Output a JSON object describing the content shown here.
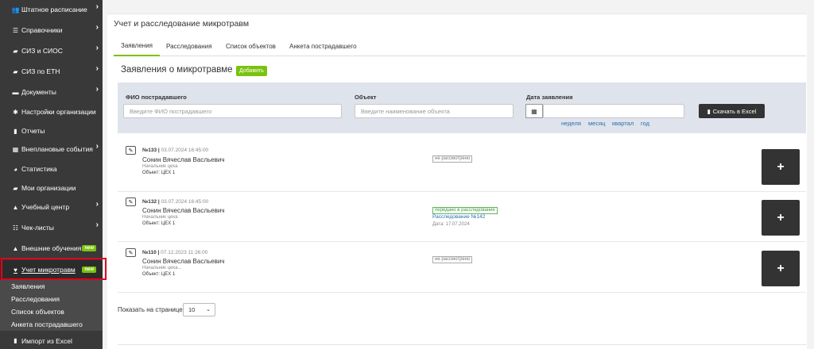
{
  "sidebar": {
    "items": [
      {
        "label": "Штатное расписание",
        "icon": "users-icon",
        "glyph": "👥",
        "chevron": true
      },
      {
        "label": "Справочники",
        "icon": "list-icon",
        "glyph": "☰",
        "chevron": true
      },
      {
        "label": "СИЗ и СИОС",
        "icon": "briefcase-icon",
        "glyph": "▰",
        "chevron": true
      },
      {
        "label": "СИЗ по ЕТН",
        "icon": "briefcase-icon",
        "glyph": "▰",
        "chevron": true
      },
      {
        "label": "Документы",
        "icon": "folder-icon",
        "glyph": "▬",
        "chevron": true
      },
      {
        "label": "Настройки организации",
        "icon": "gear-icon",
        "glyph": "✱",
        "chevron": false
      },
      {
        "label": "Отчеты",
        "icon": "clipboard-icon",
        "glyph": "▮",
        "chevron": false
      },
      {
        "label": "Внеплановые события",
        "icon": "calendar-icon",
        "glyph": "▦",
        "chevron": true
      },
      {
        "label": "Статистика",
        "icon": "pie-chart-icon",
        "glyph": "◕",
        "chevron": false
      },
      {
        "label": "Мои организации",
        "icon": "briefcase-icon",
        "glyph": "▰",
        "chevron": false
      },
      {
        "label": "Учебный центр",
        "icon": "graduation-cap-icon",
        "glyph": "▲",
        "chevron": true
      },
      {
        "label": "Чек-листы",
        "icon": "checklist-icon",
        "glyph": "☷",
        "chevron": true
      },
      {
        "label": "Внешние обучения",
        "icon": "graduation-cap-icon",
        "glyph": "▲",
        "badge": "new"
      },
      {
        "label": "Учет микротравм",
        "icon": "heart-icon",
        "glyph": "♥",
        "badge": "new"
      }
    ],
    "submenu": [
      "Заявления",
      "Расследования",
      "Список объектов",
      "Анкета пострадавшего"
    ],
    "bottom_item": {
      "label": "Импорт из Excel",
      "icon": "file-icon",
      "glyph": "▮"
    }
  },
  "page": {
    "title": "Учет и расследование микротравм",
    "tabs": [
      "Заявления",
      "Расследования",
      "Список объектов",
      "Анкета пострадавшего"
    ],
    "section_title": "Заявления о микротравме",
    "add_label": "Добавить"
  },
  "filters": {
    "fio_label": "ФИО пострадавшего",
    "fio_placeholder": "Введите ФИО пострадавшего",
    "object_label": "Объект",
    "object_placeholder": "Введите наименование объекта",
    "date_label": "Дата заявления",
    "ranges": [
      "неделя",
      "месяц",
      "квартал",
      "год"
    ],
    "excel_label": "Скачать в Excel"
  },
  "rows": [
    {
      "num": "№133",
      "date": "03.07.2024 16:45:00",
      "name": "Сонин Вячеслав Васльевич",
      "position": "Начальник цеха",
      "object": "Объект: ЦЕХ 1",
      "status": "не рассмотрено",
      "status_type": "gray",
      "investigation": "",
      "inv_date": ""
    },
    {
      "num": "№132",
      "date": "03.07.2024 16:45:00",
      "name": "Сонин Вячеслав Васльевич",
      "position": "Начальник цеха",
      "object": "Объект: ЦЕХ 1",
      "status": "передано в расследование",
      "status_type": "green",
      "investigation": "Расследование №142",
      "inv_date": "Дата: 17.07.2024"
    },
    {
      "num": "№110",
      "date": "07.12.2023 11:26:00",
      "name": "Сонин Вячеслав Васльевич",
      "position": "Начальник цеха...",
      "object": "Объект: ЦЕХ 1",
      "status": "не рассмотрено",
      "status_type": "gray",
      "investigation": "",
      "inv_date": ""
    }
  ],
  "pager": {
    "label": "Показать на странице:",
    "value": "10"
  }
}
